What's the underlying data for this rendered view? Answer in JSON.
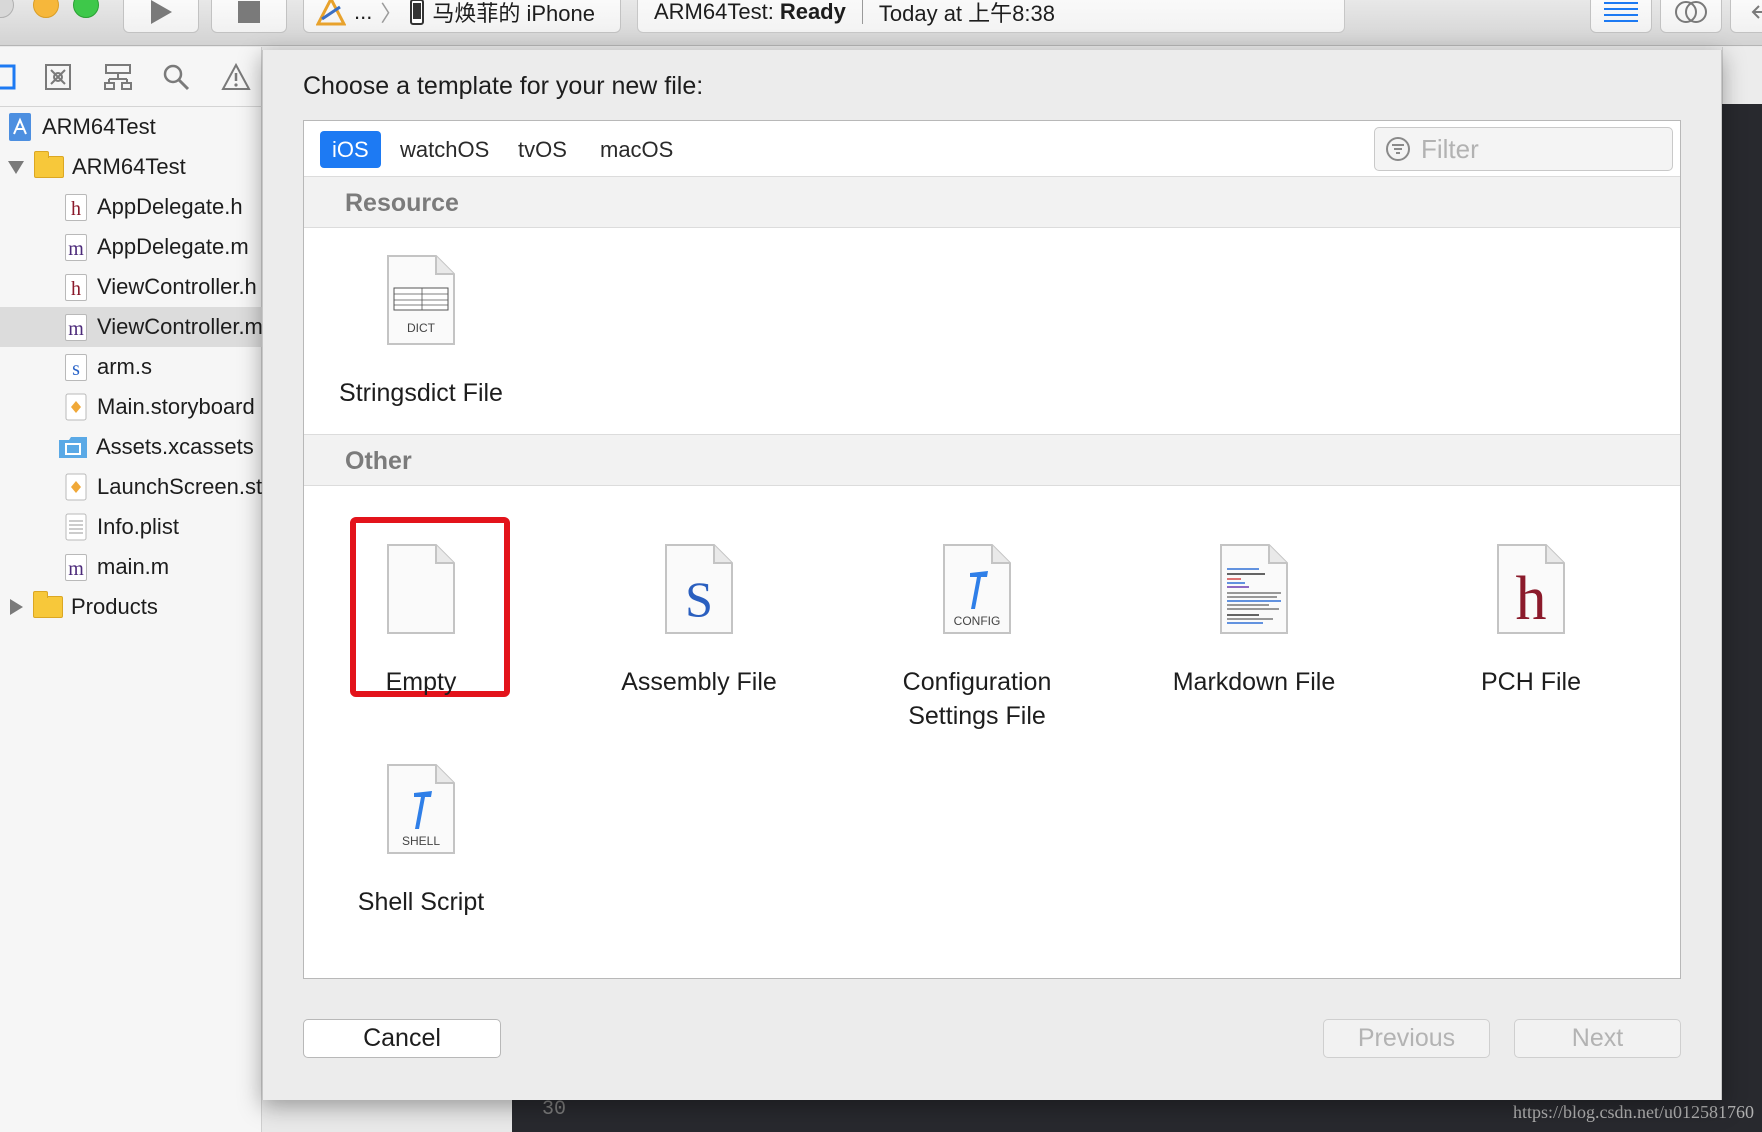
{
  "toolbar": {
    "scheme_ellipsis": "...",
    "scheme_separator": "〉",
    "device_name": "马焕菲的 iPhone",
    "status_project": "ARM64Test:",
    "status_state": "Ready",
    "status_time": "Today at 上午8:38",
    "icons": [
      "run-icon",
      "stop-icon",
      "xcode-app-icon",
      "iphone-icon",
      "standard-editor-icon",
      "assistant-editor-icon",
      "back-arrow-icon"
    ]
  },
  "navigator": {
    "tab_icons": [
      "project-navigator-icon",
      "source-control-icon",
      "symbol-navigator-icon",
      "find-icon",
      "issue-icon"
    ],
    "project": "ARM64Test",
    "group": "ARM64Test",
    "files": [
      {
        "name": "AppDelegate.h",
        "type_letter": "h",
        "type_color": "#8b1a2b"
      },
      {
        "name": "AppDelegate.m",
        "type_letter": "m",
        "type_color": "#4c2a7a"
      },
      {
        "name": "ViewController.h",
        "type_letter": "h",
        "type_color": "#8b1a2b"
      },
      {
        "name": "ViewController.m",
        "type_letter": "m",
        "type_color": "#4c2a7a",
        "selected": true
      },
      {
        "name": "arm.s",
        "type_letter": "s",
        "type_color": "#2a64c8"
      },
      {
        "name": "Main.storyboard",
        "type_letter": "",
        "type_color": "#f0a838"
      },
      {
        "name": "Assets.xcassets",
        "type_letter": "",
        "type_color": "#5aa9e6"
      },
      {
        "name": "LaunchScreen.storyboard",
        "type_letter": "",
        "type_color": "#f0a838"
      },
      {
        "name": "Info.plist",
        "type_letter": "",
        "type_color": "#7f7f7f"
      },
      {
        "name": "main.m",
        "type_letter": "m",
        "type_color": "#4c2a7a"
      }
    ],
    "products": "Products"
  },
  "dialog": {
    "title": "Choose a template for your new file:",
    "os_tabs": [
      "iOS",
      "watchOS",
      "tvOS",
      "macOS"
    ],
    "selected_tab": "iOS",
    "filter_placeholder": "Filter",
    "sections": [
      {
        "title": "Resource",
        "templates": [
          {
            "label": "Stringsdict File",
            "badge": "DICT",
            "icon": "stringsdict-file-icon"
          }
        ]
      },
      {
        "title": "Other",
        "templates": [
          {
            "label": "Empty",
            "badge": "",
            "icon": "empty-file-icon",
            "highlighted": true
          },
          {
            "label": "Assembly File",
            "badge": "S",
            "icon": "assembly-file-icon"
          },
          {
            "label": "Configuration Settings File",
            "label_line1": "Configuration",
            "label_line2": "Settings File",
            "badge": "CONFIG",
            "icon": "config-file-icon"
          },
          {
            "label": "Markdown File",
            "badge": "",
            "icon": "markdown-file-icon"
          },
          {
            "label": "PCH File",
            "badge": "h",
            "icon": "pch-file-icon"
          },
          {
            "label": "Shell Script",
            "badge": "SHELL",
            "icon": "shell-script-icon"
          }
        ]
      }
    ],
    "buttons": {
      "cancel": "Cancel",
      "previous": "Previous",
      "next": "Next"
    }
  },
  "editor": {
    "line_number": "30"
  },
  "watermark": "https://blog.csdn.net/u012581760",
  "colors": {
    "accent": "#1d7af3",
    "highlight": "#e3131b"
  }
}
